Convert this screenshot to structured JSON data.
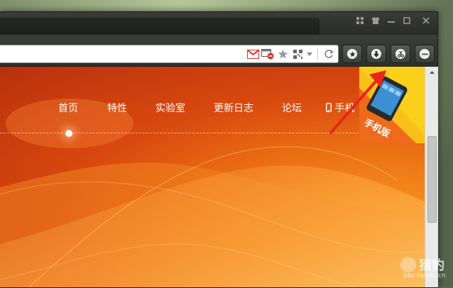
{
  "nav": {
    "items": [
      {
        "label": "首页"
      },
      {
        "label": "特性"
      },
      {
        "label": "实验室"
      },
      {
        "label": "更新日志"
      },
      {
        "label": "论坛"
      },
      {
        "label": "手机"
      }
    ]
  },
  "mobile_badge": {
    "label": "手机版"
  },
  "address_bar": {
    "icons": [
      "gmail-icon",
      "screenshot-block-icon",
      "favorite-star-icon",
      "qr-code-icon",
      "dropdown-icon",
      "refresh-icon"
    ]
  },
  "toolbar_buttons": [
    "favorites-star-icon",
    "download-icon",
    "scissors-icon",
    "more-icon"
  ],
  "window_controls": [
    "grid-icon",
    "skin-shirt-icon",
    "minimize-icon",
    "maximize-icon",
    "close-icon"
  ],
  "watermark": {
    "brand": "猎豹",
    "url": "bbs.liebao.cn"
  },
  "colors": {
    "accent": "#ea6d13",
    "badge": "#fccf1b",
    "arrow": "#e8261b"
  }
}
